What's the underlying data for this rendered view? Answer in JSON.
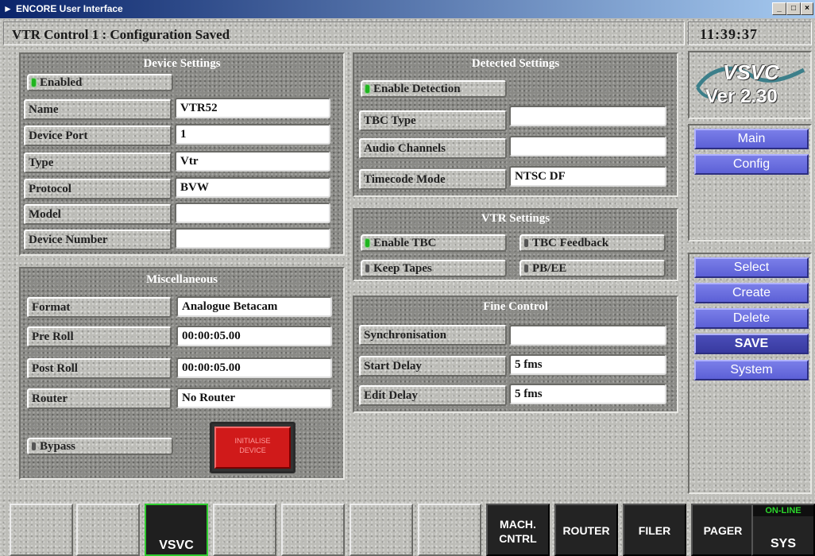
{
  "window": {
    "title": "ENCORE User Interface",
    "min": "_",
    "max": "□",
    "close": "×"
  },
  "status": {
    "message": "VTR Control 1 : Configuration Saved",
    "time": "11:39:37"
  },
  "device_settings": {
    "title": "Device Settings",
    "enabled_label": "Enabled",
    "fields": [
      {
        "label": "Name",
        "value": "VTR52"
      },
      {
        "label": "Device Port",
        "value": "1"
      },
      {
        "label": "Type",
        "value": "Vtr"
      },
      {
        "label": "Protocol",
        "value": "BVW"
      },
      {
        "label": "Model",
        "value": ""
      },
      {
        "label": "Device Number",
        "value": ""
      }
    ]
  },
  "miscellaneous": {
    "title": "Miscellaneous",
    "fields": [
      {
        "label": "Format",
        "value": "Analogue Betacam"
      },
      {
        "label": "Pre Roll",
        "value": "00:00:05.00"
      },
      {
        "label": "Post Roll",
        "value": "00:00:05.00"
      },
      {
        "label": "Router",
        "value": "No Router"
      }
    ],
    "bypass_label": "Bypass",
    "initialise_line1": "INITIALISE",
    "initialise_line2": "DEVICE"
  },
  "detected_settings": {
    "title": "Detected Settings",
    "enable_label": "Enable Detection",
    "fields": [
      {
        "label": "TBC Type",
        "value": ""
      },
      {
        "label": "Audio Channels",
        "value": ""
      },
      {
        "label": "Timecode Mode",
        "value": "NTSC DF"
      }
    ]
  },
  "vtr_settings": {
    "title": "VTR Settings",
    "toggles": [
      {
        "label": "Enable TBC",
        "on": true
      },
      {
        "label": "TBC Feedback",
        "on": false
      },
      {
        "label": "Keep Tapes",
        "on": false
      },
      {
        "label": "PB/EE",
        "on": false
      }
    ]
  },
  "fine_control": {
    "title": "Fine Control",
    "fields": [
      {
        "label": "Synchronisation",
        "value": ""
      },
      {
        "label": "Start Delay",
        "value": "5 fms"
      },
      {
        "label": "Edit Delay",
        "value": "5 fms"
      }
    ]
  },
  "logo": {
    "line1": "VSVC",
    "line2": "Ver 2.30"
  },
  "side_nav": {
    "main": "Main",
    "config": "Config"
  },
  "side_actions": {
    "select": "Select",
    "create": "Create",
    "delete": "Delete",
    "save": "SAVE",
    "system": "System"
  },
  "function_keys": {
    "vsvc": "VSVC",
    "mach_line1": "MACH.",
    "mach_line2": "CNTRL",
    "router": "ROUTER",
    "filer": "FILER",
    "pager": "PAGER",
    "online": "ON-LINE",
    "sys": "SYS"
  },
  "colors": {
    "accent_blue": "#5c60d6",
    "led_on": "#1fb41f",
    "init_red": "#d01a1a",
    "active_border": "#2ecb2e"
  }
}
